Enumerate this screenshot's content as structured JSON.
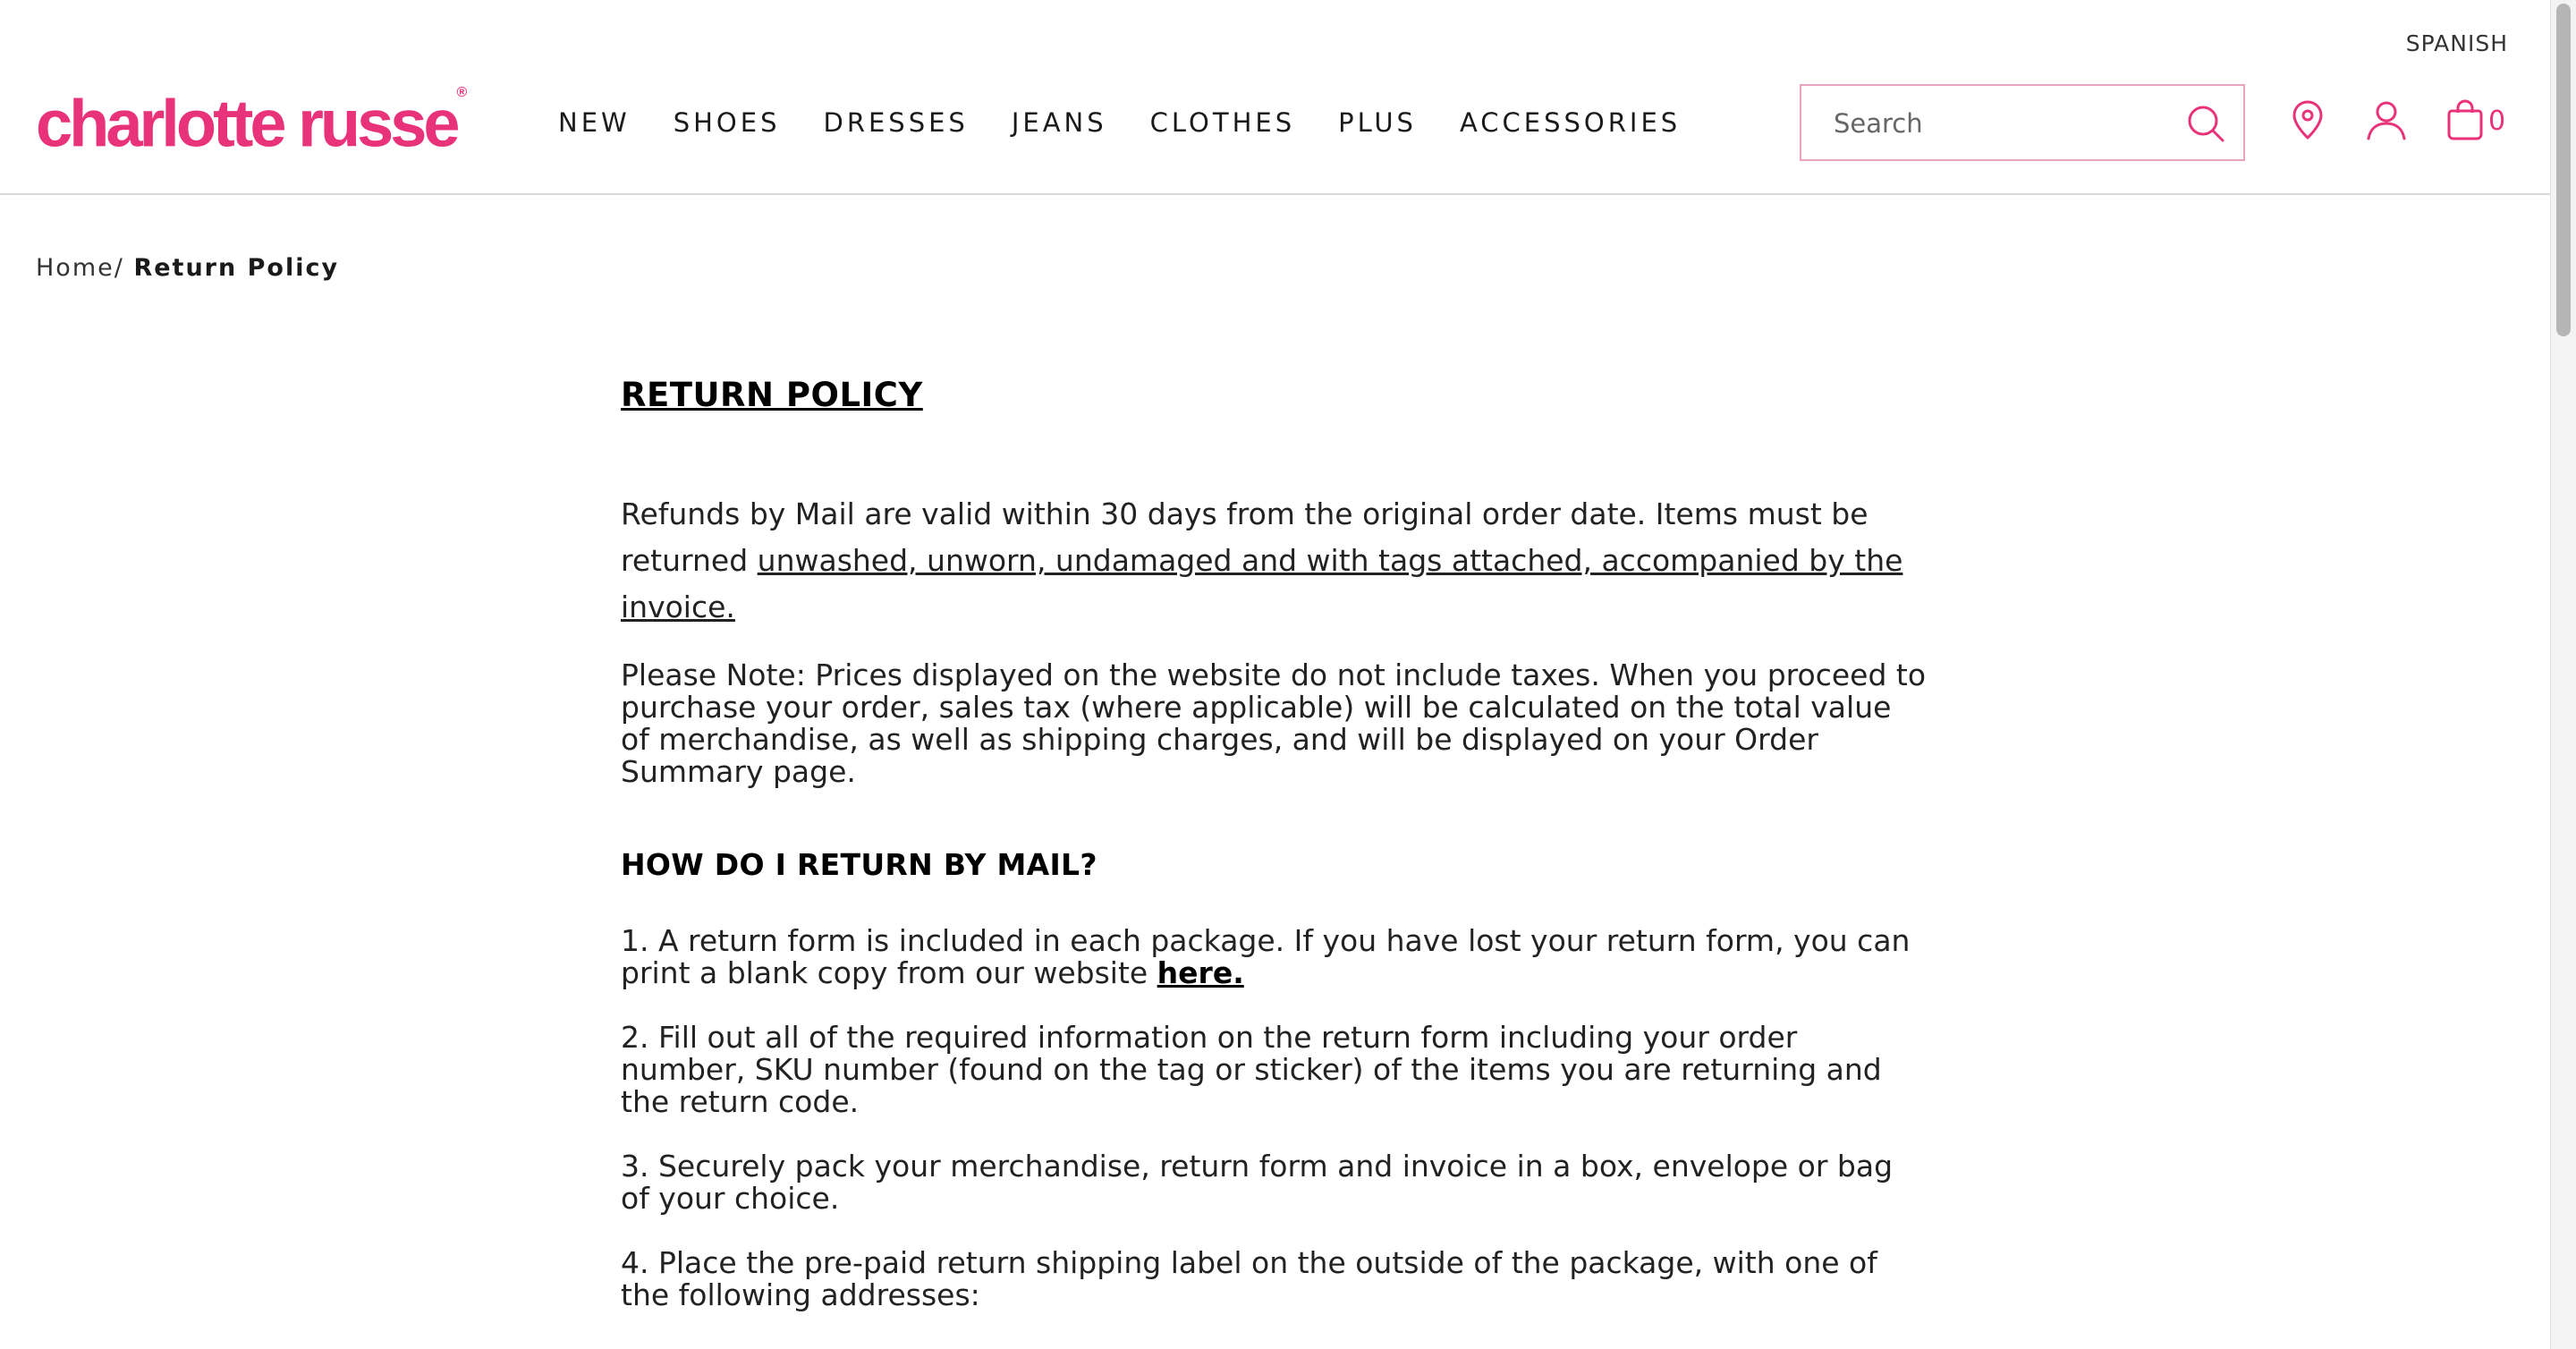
{
  "header": {
    "language_link": "SPANISH",
    "logo_text": "charlotte russe",
    "logo_mark": "®",
    "nav": [
      "NEW",
      "SHOES",
      "DRESSES",
      "JEANS",
      "CLOTHES",
      "PLUS",
      "ACCESSORIES"
    ],
    "search_placeholder": "Search",
    "cart_count": "0",
    "icons": [
      "search-icon",
      "location-pin-icon",
      "user-icon",
      "shopping-bag-icon"
    ]
  },
  "breadcrumb": {
    "home": "Home",
    "separator": "/",
    "current": "Return Policy"
  },
  "content": {
    "title": "RETURN POLICY",
    "p1_text": "Refunds by Mail are valid within 30 days from the original order date. Items must be returned ",
    "p1_underlined": "unwashed, unworn, undamaged and with tags attached, accompanied by the invoice.",
    "p2": "Please Note: Prices displayed on the website do not include taxes. When you proceed to purchase your order, sales tax  (where applicable) will be calculated on the total value of merchandise, as well as shipping charges, and will be displayed on your Order Summary page.",
    "section_heading": "HOW DO I RETURN BY MAIL?",
    "step1_text": "1. A return form is included in each package. If you have lost your return form, you can print a blank copy from our website ",
    "step1_link": "here.",
    "step2": "2. Fill out all of the required information on the return form including your order number, SKU number (found on the tag or sticker) of the items you are returning and the return code.",
    "step3": "3. Securely pack your merchandise, return form and invoice in a box, envelope or bag of your choice.",
    "step4": "4. Place the pre-paid return shipping label on the outside of the package, with one of the following addresses:"
  },
  "colors": {
    "brand": "#e8337a",
    "search_border": "#e8a3c0",
    "text": "#1a1a1a"
  }
}
